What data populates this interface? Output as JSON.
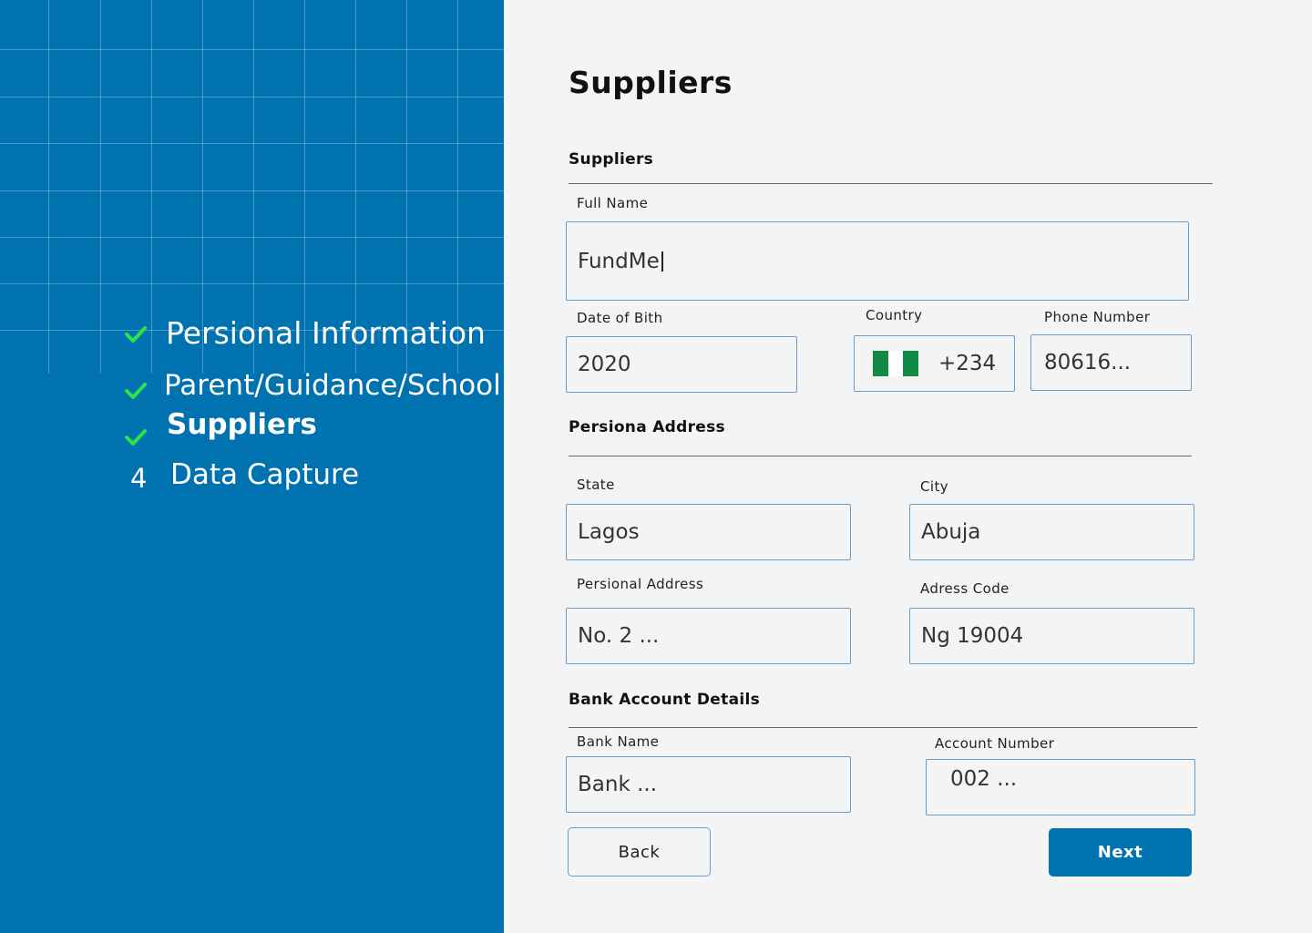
{
  "sidebar": {
    "steps": [
      {
        "label": "Persional Information",
        "status": "complete"
      },
      {
        "label": "Parent/Guidance/School",
        "status": "complete"
      },
      {
        "label": "Suppliers",
        "status": "complete"
      },
      {
        "label": "Data Capture",
        "number": "4",
        "status": "pending"
      }
    ]
  },
  "colors": {
    "primary": "#0072b0",
    "check": "#2ee34a",
    "field_border": "#6a9ccc"
  },
  "page": {
    "title": "Suppliers"
  },
  "sections": {
    "suppliers": {
      "title": "Suppliers"
    },
    "address": {
      "title": "Persiona Address"
    },
    "bank": {
      "title": "Bank Account Details"
    }
  },
  "fields": {
    "full_name": {
      "label": "Full Name",
      "value": "FundMe"
    },
    "dob": {
      "label": "Date of Bith",
      "value": "2020"
    },
    "country": {
      "label": "Country",
      "value": "+234",
      "flag": "nigeria-flag"
    },
    "phone": {
      "label": "Phone Number",
      "value": "80616..."
    },
    "state": {
      "label": "State",
      "value": "Lagos"
    },
    "city": {
      "label": "City",
      "value": "Abuja"
    },
    "address": {
      "label": "Persional Address",
      "value": "No. 2 ..."
    },
    "address_code": {
      "label": "Adress Code",
      "value": "Ng 19004"
    },
    "bank_name": {
      "label": "Bank Name",
      "value": "Bank ..."
    },
    "account_number": {
      "label": "Account Number",
      "value": "002 ..."
    }
  },
  "buttons": {
    "back": "Back",
    "next": "Next"
  }
}
